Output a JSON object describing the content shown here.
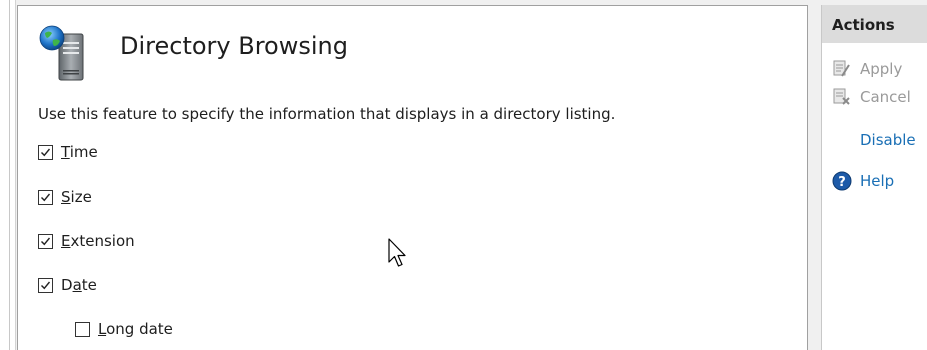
{
  "feature": {
    "title": "Directory Browsing",
    "description": "Use this feature to specify the information that displays in a directory listing.",
    "icon": "globe-server-icon"
  },
  "options": [
    {
      "label": "Time",
      "access_key_index": 0,
      "checked": true
    },
    {
      "label": "Size",
      "access_key_index": 0,
      "checked": true
    },
    {
      "label": "Extension",
      "access_key_index": 0,
      "checked": true
    },
    {
      "label": "Date",
      "access_key_index": 1,
      "checked": true
    },
    {
      "label": "Long date",
      "access_key_index": 0,
      "checked": false
    }
  ],
  "actions": {
    "header": "Actions",
    "apply_label": "Apply",
    "cancel_label": "Cancel",
    "disable_label": "Disable",
    "help_label": "Help",
    "apply_icon": "apply-icon",
    "cancel_icon": "cancel-icon",
    "help_icon": "help-icon"
  },
  "colors": {
    "link": "#1a6fb5",
    "disabled_text": "#9a9a9a",
    "header_bg": "#dcdcdc"
  }
}
